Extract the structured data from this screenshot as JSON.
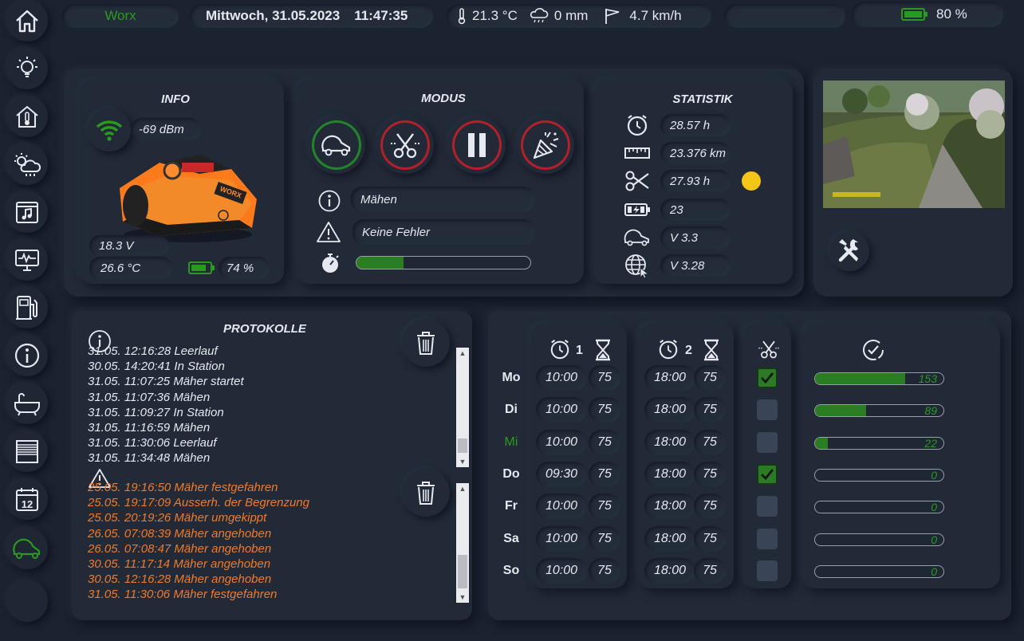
{
  "top": {
    "brand": "Worx",
    "date": "Mittwoch, 31.05.2023",
    "time": "11:47:35",
    "temperature": "21.3 °C",
    "rain": "0 mm",
    "wind": "4.7 km/h",
    "battery": "80 %"
  },
  "sidebar": [
    "home-icon",
    "bulb-icon",
    "house-thermometer-icon",
    "weather-icon",
    "music-icon",
    "monitor-icon",
    "fuel-icon",
    "info-icon",
    "bathtub-icon",
    "blinds-icon",
    "calendar-icon",
    "mower-icon"
  ],
  "calendar_day": "12",
  "info": {
    "title": "INFO",
    "signal": "-69 dBm",
    "voltage": "18.3 V",
    "temperature": "26.6 °C",
    "battery": "74 %"
  },
  "modus": {
    "title": "MODUS",
    "status": "Mähen",
    "error": "Keine Fehler",
    "progress": 0.27
  },
  "statistik": {
    "title": "STATISTIK",
    "worktime": "28.57 h",
    "distance": "23.376 km",
    "blade_time": "27.93 h",
    "charge_cycles": "23",
    "firmware": "V 3.3",
    "web_version": "V 3.28"
  },
  "protokolle": {
    "title": "PROTOKOLLE",
    "status_log": [
      "31.05. 12:16:28 Leerlauf",
      "30.05. 14:20:41 In Station",
      "31.05. 11:07:25 Mäher startet",
      "31.05. 11:07:36 Mähen",
      "31.05. 11:09:27 In Station",
      "31.05. 11:16:59 Mähen",
      "31.05. 11:30:06 Leerlauf",
      "31.05. 11:34:48 Mähen"
    ],
    "error_log": [
      "25.05. 19:16:50 Mäher festgefahren",
      "25.05. 19:17:09 Ausserh. der Begrenzung",
      "25.05. 20:19:26 Mäher umgekippt",
      "26.05. 07:08:39 Mäher angehoben",
      "26.05. 07:08:47 Mäher angehoben",
      "30.05. 11:17:14 Mäher angehoben",
      "30.05. 12:16:28 Mäher angehoben",
      "31.05. 11:30:06 Mäher festgefahren"
    ]
  },
  "schedule": {
    "slot1_label": "1",
    "slot2_label": "2",
    "days": [
      {
        "day": "Mo",
        "t1": "10:00",
        "d1": "75",
        "t2": "18:00",
        "d2": "75",
        "edge": true,
        "pct": 153,
        "fill": 0.7
      },
      {
        "day": "Di",
        "t1": "10:00",
        "d1": "75",
        "t2": "18:00",
        "d2": "75",
        "edge": false,
        "pct": 89,
        "fill": 0.4
      },
      {
        "day": "Mi",
        "t1": "10:00",
        "d1": "75",
        "t2": "18:00",
        "d2": "75",
        "edge": false,
        "pct": 22,
        "fill": 0.1,
        "today": true
      },
      {
        "day": "Do",
        "t1": "09:30",
        "d1": "75",
        "t2": "18:00",
        "d2": "75",
        "edge": true,
        "pct": 0,
        "fill": 0
      },
      {
        "day": "Fr",
        "t1": "10:00",
        "d1": "75",
        "t2": "18:00",
        "d2": "75",
        "edge": false,
        "pct": 0,
        "fill": 0
      },
      {
        "day": "Sa",
        "t1": "10:00",
        "d1": "75",
        "t2": "18:00",
        "d2": "75",
        "edge": false,
        "pct": 0,
        "fill": 0
      },
      {
        "day": "So",
        "t1": "10:00",
        "d1": "75",
        "t2": "18:00",
        "d2": "75",
        "edge": false,
        "pct": 0,
        "fill": 0
      }
    ]
  },
  "colors": {
    "accent_green": "#2a9b1f",
    "log_orange": "#f07a2a",
    "ring_red": "#b3202a",
    "ring_green": "#23852a",
    "status_dot": "#f5c518"
  }
}
